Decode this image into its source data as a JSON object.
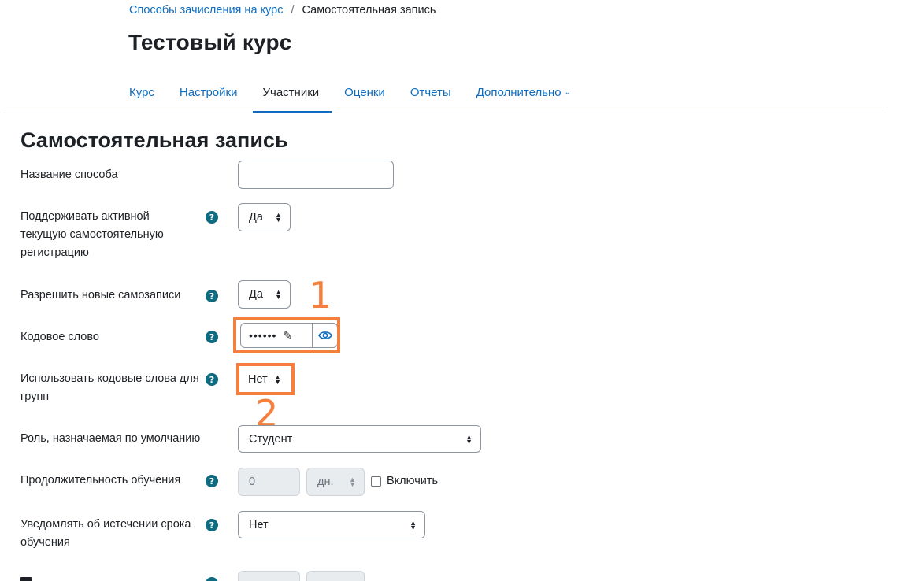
{
  "breadcrumb": {
    "link": "Способы зачисления на курс",
    "separator": "/",
    "current": "Самостоятельная запись"
  },
  "course_title": "Тестовый курс",
  "tabs": [
    {
      "label": "Курс"
    },
    {
      "label": "Настройки"
    },
    {
      "label": "Участники",
      "active": true
    },
    {
      "label": "Оценки"
    },
    {
      "label": "Отчеты"
    },
    {
      "label": "Дополнительно"
    }
  ],
  "page_heading": "Самостоятельная запись",
  "form": {
    "name_label": "Название способа",
    "name_value": "",
    "keep_active_label": "Поддерживать активной текущую самостоятельную регистрацию",
    "keep_active_value": "Да",
    "allow_new_label": "Разрешить новые самозаписи",
    "allow_new_value": "Да",
    "keyword_label": "Кодовое слово",
    "keyword_value": "••••••",
    "group_keys_label": "Использовать кодовые слова для групп",
    "group_keys_value": "Нет",
    "default_role_label": "Роль, назначаемая по умолчанию",
    "default_role_value": "Студент",
    "duration_label": "Продолжительность обучения",
    "duration_value": "0",
    "duration_unit": "дн.",
    "enable_label": "Включить",
    "expiry_notify_label": "Уведомлять об истечении срока обучения",
    "expiry_notify_value": "Нет"
  },
  "annotations": {
    "one": "1",
    "two": "2"
  },
  "colors": {
    "link": "#0f6cbf",
    "annotation": "#f57f3c",
    "help_icon": "#0f6b80"
  }
}
